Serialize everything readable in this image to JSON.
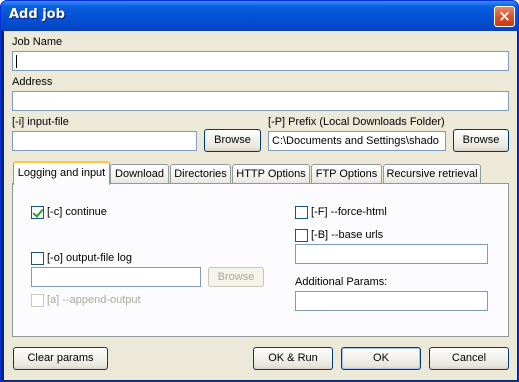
{
  "window": {
    "title": "Add job",
    "close_glyph": "×"
  },
  "job_name": {
    "label": "Job Name",
    "value": ""
  },
  "address": {
    "label": "Address",
    "value": ""
  },
  "input_file": {
    "label": "[-i] input-file",
    "value": "",
    "browse_label": "Browse"
  },
  "prefix": {
    "label": "[-P] Prefix (Local Downloads Folder)",
    "value": "C:\\Documents and Settings\\shado",
    "browse_label": "Browse"
  },
  "tabs": [
    {
      "label": "Logging and input",
      "active": true
    },
    {
      "label": "Download"
    },
    {
      "label": "Directories"
    },
    {
      "label": "HTTP Options"
    },
    {
      "label": "FTP Options"
    },
    {
      "label": "Recursive retrieval"
    }
  ],
  "logging": {
    "continue_label": "[-c] continue",
    "continue_checked": true,
    "output_log_label": "[-o] output-file log",
    "output_log_checked": false,
    "output_log_value": "",
    "output_browse_label": "Browse",
    "append_output_label": "[a] --append-output",
    "force_html_label": "[-F] --force-html",
    "base_urls_label": "[-B] --base urls",
    "base_urls_value": "",
    "additional_params_label": "Additional Params:",
    "additional_params_value": ""
  },
  "footer": {
    "clear_label": "Clear params",
    "ok_run_label": "OK & Run",
    "ok_label": "OK",
    "cancel_label": "Cancel"
  },
  "colors": {
    "titlebar": "#0553d8",
    "dialog_bg": "#ece9d8",
    "tab_highlight": "#ffc83c",
    "check_mark": "#21a121"
  }
}
